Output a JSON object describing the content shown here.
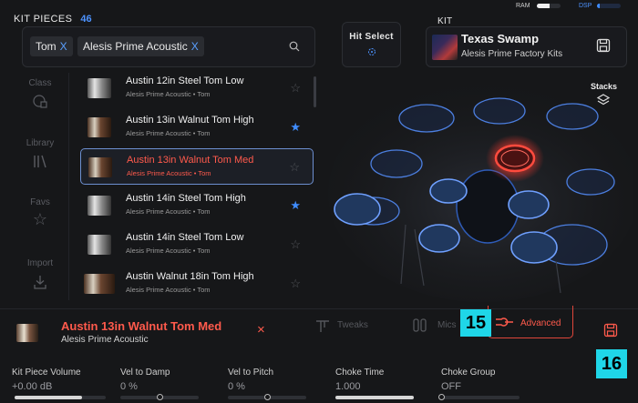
{
  "kit_pieces": {
    "title": "KIT PIECES",
    "count": "46"
  },
  "filters": [
    {
      "label": "Tom",
      "remove": "X"
    },
    {
      "label": "Alesis Prime Acoustic",
      "remove": "X"
    }
  ],
  "hit_select": {
    "label": "Hit Select"
  },
  "kit": {
    "label": "KIT",
    "name": "Texas Swamp",
    "subtitle": "Alesis Prime Factory Kits"
  },
  "meters": {
    "ram": "RAM",
    "dsp": "DSP",
    "ram_level": 0.55,
    "dsp_level": 0.1
  },
  "stacks": {
    "label": "Stacks"
  },
  "sidebar": [
    {
      "label": "Class",
      "icon": "class-icon"
    },
    {
      "label": "Library",
      "icon": "library-icon"
    },
    {
      "label": "Favs",
      "icon": "star-icon"
    },
    {
      "label": "Import",
      "icon": "import-icon"
    }
  ],
  "pieces": [
    {
      "name": "Austin 12in Steel Tom Low",
      "sub": "Alesis Prime Acoustic • Tom",
      "fav": false,
      "selected": false
    },
    {
      "name": "Austin 13in Walnut Tom High",
      "sub": "Alesis Prime Acoustic • Tom",
      "fav": true,
      "selected": false
    },
    {
      "name": "Austin 13in Walnut Tom Med",
      "sub": "Alesis Prime Acoustic • Tom",
      "fav": false,
      "selected": true
    },
    {
      "name": "Austin 14in Steel Tom High",
      "sub": "Alesis Prime Acoustic • Tom",
      "fav": true,
      "selected": false
    },
    {
      "name": "Austin 14in Steel Tom Low",
      "sub": "Alesis Prime Acoustic • Tom",
      "fav": false,
      "selected": false
    },
    {
      "name": "Austin Walnut 18in Tom High",
      "sub": "Alesis Prime Acoustic • Tom",
      "fav": false,
      "selected": false
    }
  ],
  "selected_piece": {
    "name": "Austin 13in Walnut Tom Med",
    "library": "Alesis Prime Acoustic",
    "close": "×"
  },
  "tabs": [
    {
      "label": "Tweaks",
      "active": false
    },
    {
      "label": "Mics",
      "active": false
    },
    {
      "label": "Advanced",
      "active": true
    }
  ],
  "controls": [
    {
      "label": "Kit Piece Volume",
      "value": "+0.00 dB",
      "level": 0.74
    },
    {
      "label": "Vel to Damp",
      "value": "0 %",
      "level": 0.5
    },
    {
      "label": "Vel to Pitch",
      "value": "0 %",
      "level": 0.5
    },
    {
      "label": "Choke Time",
      "value": "1.000",
      "level": 1.0
    },
    {
      "label": "Choke Group",
      "value": "OFF",
      "level": 0.0
    }
  ],
  "badges": {
    "b15": "15",
    "b16": "16"
  },
  "colors": {
    "accent_red": "#ff5a4c",
    "accent_blue": "#3f8cff",
    "badge": "#1fd6e8"
  }
}
